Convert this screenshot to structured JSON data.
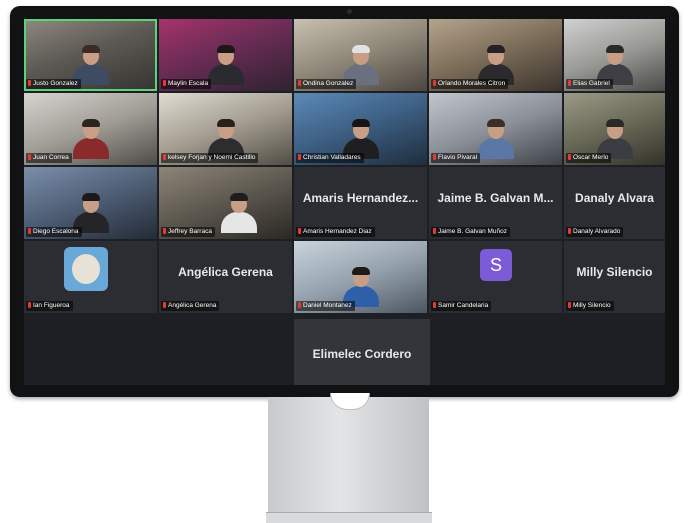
{
  "meeting": {
    "row1": [
      {
        "label": "Justo Gonzalez",
        "kind": "video",
        "active": true
      },
      {
        "label": "Maylin Escala",
        "kind": "video"
      },
      {
        "label": "Ondina Gonzalez",
        "kind": "video"
      },
      {
        "label": "Orlando Morales Citron",
        "kind": "video"
      },
      {
        "label": "Elias Gabriel",
        "kind": "video"
      }
    ],
    "row2": [
      {
        "label": "Juan Correa",
        "kind": "video"
      },
      {
        "label": "kelsey Forjan y Noemi Castillo",
        "kind": "video"
      },
      {
        "label": "Christian Valladares",
        "kind": "video"
      },
      {
        "label": "Flavio Pivaral",
        "kind": "video"
      },
      {
        "label": "Oscar Merlo",
        "kind": "video"
      }
    ],
    "row3": [
      {
        "label": "Diego Escalona",
        "kind": "video"
      },
      {
        "label": "Jeffrey Barraca",
        "kind": "video"
      },
      {
        "label": "Amaris Hernandez Diaz",
        "big": "Amaris Hernandez..."
      },
      {
        "label": "Jaime B. Galvan Muñoz",
        "big": "Jaime B. Galvan M..."
      },
      {
        "label": "Danaly Alvarado",
        "big": "Danaly Alvara"
      }
    ],
    "row4": [
      {
        "label": "Ian Figueroa",
        "kind": "cartoon"
      },
      {
        "label": "Angélica Gerena",
        "big": "Angélica Gerena"
      },
      {
        "label": "Daniel Montanez",
        "kind": "video"
      },
      {
        "label": "Samir Candelaria",
        "avatar": "S"
      },
      {
        "label": "Milly Silencio",
        "big": "Milly Silencio"
      }
    ],
    "row5": {
      "big": "Elimelec Cordero"
    }
  }
}
